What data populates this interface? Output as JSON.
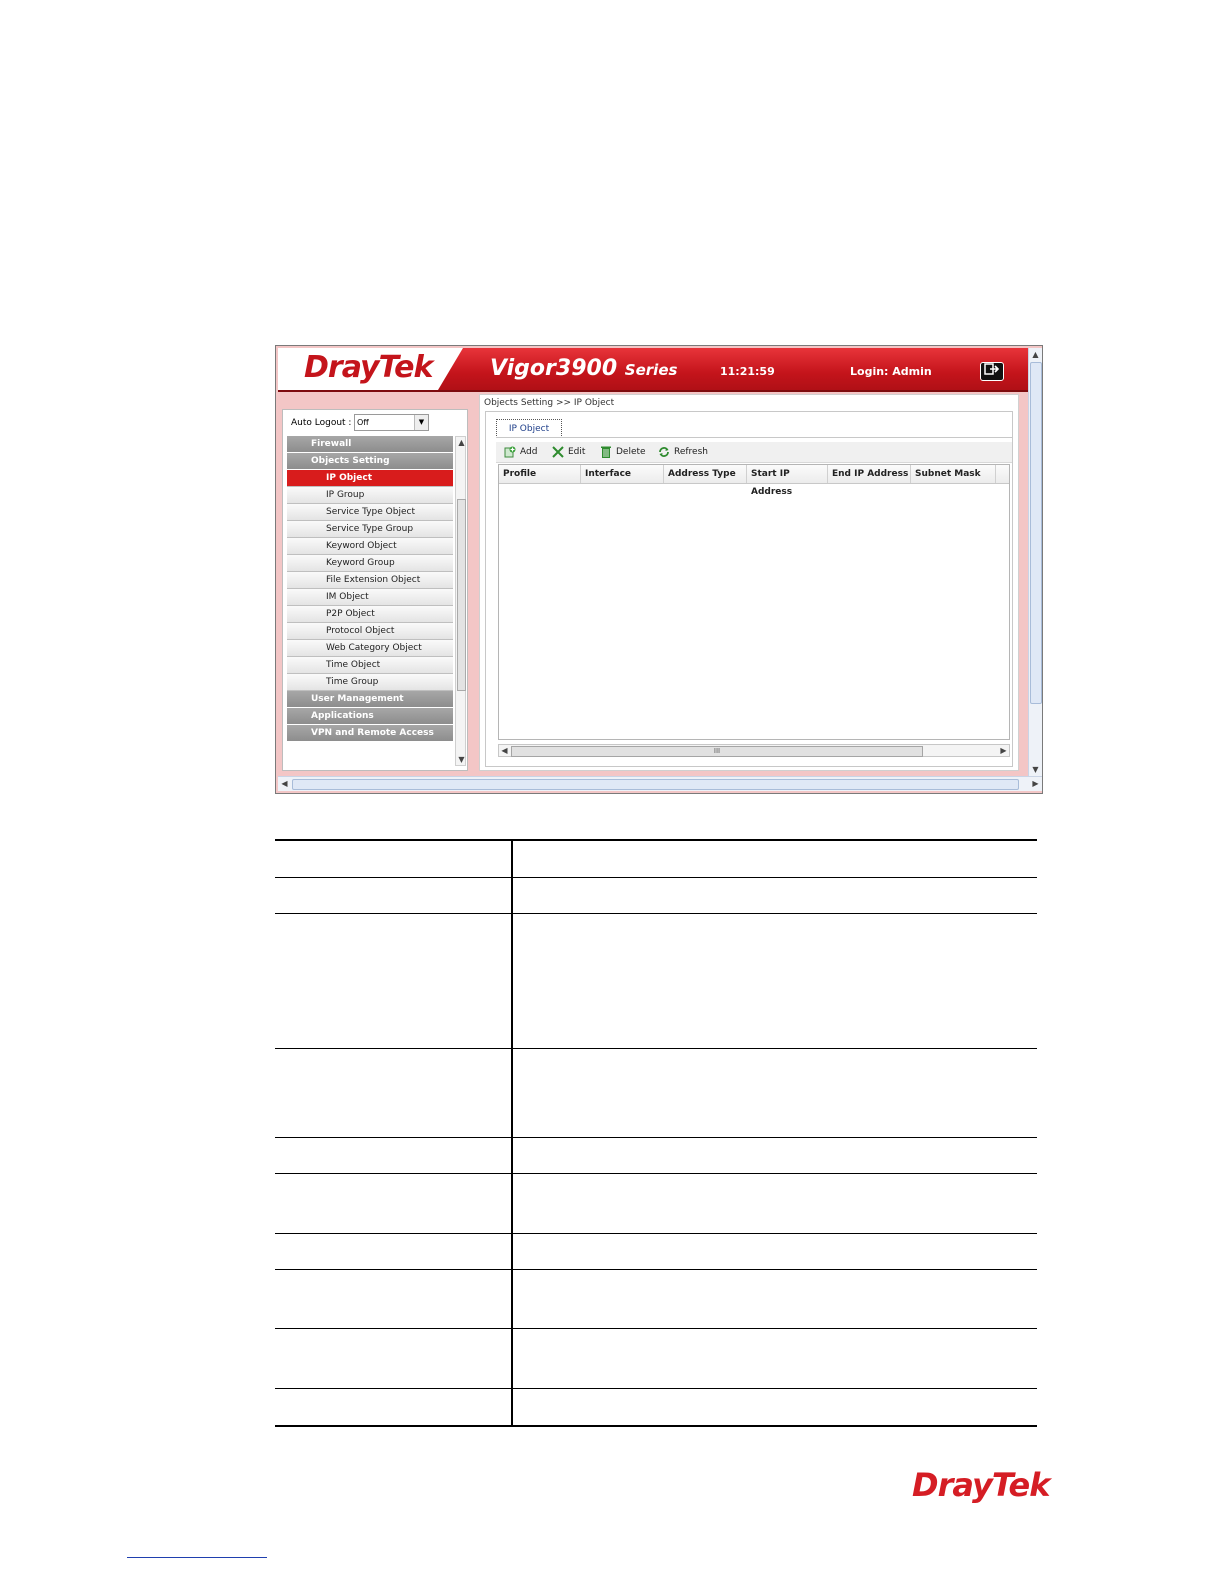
{
  "header": {
    "brand_logo": "DrayTek",
    "model": "Vigor3900",
    "model_suffix": "Series",
    "clock": "11:21:59",
    "login": "Login: Admin",
    "logout_icon": "logout-icon"
  },
  "sidebar": {
    "auto_logout_label": "Auto Logout :",
    "auto_logout_value": "Off",
    "items": [
      {
        "label": "Firewall",
        "type": "cat"
      },
      {
        "label": "Objects Setting",
        "type": "cat"
      },
      {
        "label": "IP Object",
        "type": "sub",
        "active": true
      },
      {
        "label": "IP Group",
        "type": "sub"
      },
      {
        "label": "Service Type Object",
        "type": "sub"
      },
      {
        "label": "Service Type Group",
        "type": "sub"
      },
      {
        "label": "Keyword Object",
        "type": "sub"
      },
      {
        "label": "Keyword Group",
        "type": "sub"
      },
      {
        "label": "File Extension Object",
        "type": "sub"
      },
      {
        "label": "IM Object",
        "type": "sub"
      },
      {
        "label": "P2P Object",
        "type": "sub"
      },
      {
        "label": "Protocol Object",
        "type": "sub"
      },
      {
        "label": "Web Category Object",
        "type": "sub"
      },
      {
        "label": "Time Object",
        "type": "sub"
      },
      {
        "label": "Time Group",
        "type": "sub"
      },
      {
        "label": "User Management",
        "type": "cat"
      },
      {
        "label": "Applications",
        "type": "cat"
      },
      {
        "label": "VPN and Remote Access",
        "type": "cat"
      }
    ]
  },
  "main": {
    "breadcrumb": "Objects Setting >> IP Object",
    "tab_label": "IP Object",
    "toolbar": {
      "add_label": "Add",
      "edit_label": "Edit",
      "delete_label": "Delete",
      "refresh_label": "Refresh"
    },
    "grid": {
      "columns": [
        "Profile",
        "Interface",
        "Address Type",
        "Start IP Address",
        "End IP Address",
        "Subnet Mask"
      ],
      "hscroll_grip": "III"
    }
  },
  "footer": {
    "logo": "DrayTek"
  },
  "colors": {
    "brand_red": "#c4141b",
    "menu_active": "#d81c1c",
    "link_blue": "#1f3fae"
  }
}
